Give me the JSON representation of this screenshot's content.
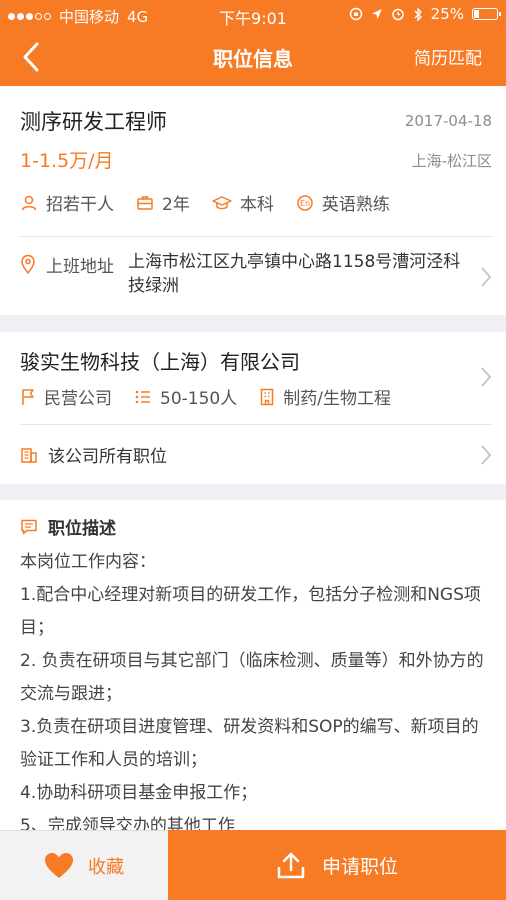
{
  "status_bar": {
    "carrier": "中国移动",
    "network": "4G",
    "time": "下午9:01",
    "battery": "25%",
    "battery_level": 0.25
  },
  "nav": {
    "title": "职位信息",
    "right_action": "简历匹配"
  },
  "job": {
    "title": "测序研发工程师",
    "date": "2017-04-18",
    "salary": "1-1.5万/月",
    "location": "上海-松江区",
    "requirements": [
      {
        "icon": "person-icon",
        "text": "招若干人"
      },
      {
        "icon": "briefcase-icon",
        "text": "2年"
      },
      {
        "icon": "graduation-cap-icon",
        "text": "本科"
      },
      {
        "icon": "language-icon",
        "text": "英语熟练"
      }
    ],
    "address_label": "上班地址",
    "address": "上海市松江区九亭镇中心路1158号漕河泾科技绿洲"
  },
  "company": {
    "name": "骏实生物科技（上海）有限公司",
    "type": "民营公司",
    "size": "50-150人",
    "industry": "制药/生物工程",
    "all_jobs_label": "该公司所有职位"
  },
  "description": {
    "heading": "职位描述",
    "lines": [
      "本岗位工作内容：",
      "1.配合中心经理对新项目的研发工作，包括分子检测和NGS项目；",
      "2. 负责在研项目与其它部门（临床检测、质量等）和外协方的交流与跟进；",
      "3.负责在研项目进度管理、研发资料和SOP的编写、新项目的验证工作和人员的培训；",
      "4.协助科研项目基金申报工作；",
      "5、完成领导交办的其他工作"
    ]
  },
  "bottom": {
    "favorite_label": "收藏",
    "apply_label": "申请职位"
  },
  "colors": {
    "accent": "#f77a25",
    "background": "#efeff4"
  }
}
